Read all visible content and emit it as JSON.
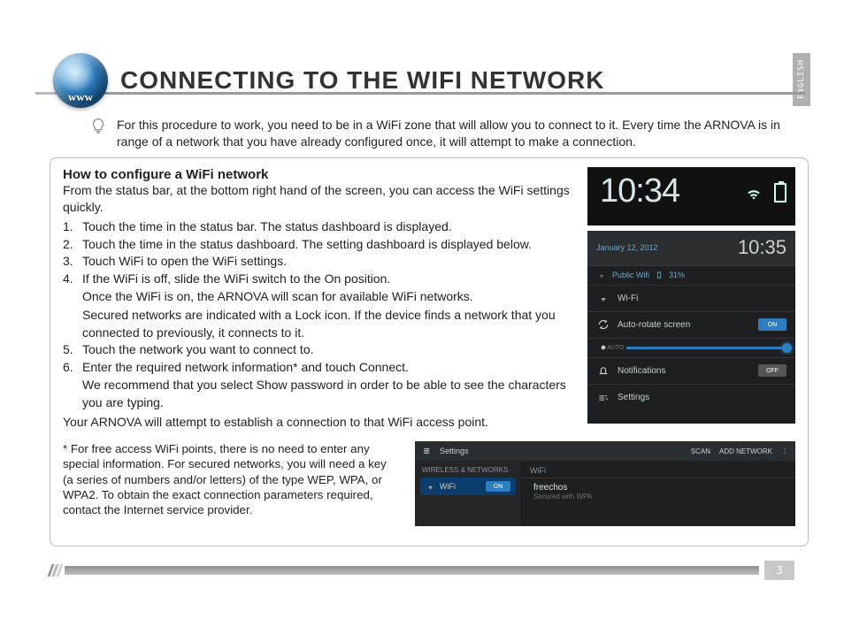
{
  "lang_tab": "ENGLISH",
  "globe_text": "www",
  "page_title": "CONNECTING TO THE WIFI NETWORK",
  "intro": "For this procedure to work, you need to be in a WiFi zone that will allow you to connect to it. Every time the ARNOVA is in range of a network that you have already configured once, it will attempt to make a connection.",
  "box": {
    "heading": "How to configure a WiFi network",
    "desc": "From the status bar, at the bottom right hand of the screen, you can access the WiFi settings quickly.",
    "steps": [
      {
        "n": "1.",
        "t": "Touch the time in the status bar. The status dashboard is displayed."
      },
      {
        "n": "2.",
        "t": "Touch the time in the status dashboard. The setting dashboard is displayed below."
      },
      {
        "n": "3.",
        "t": "Touch WiFi to open the WiFi settings."
      },
      {
        "n": "4.",
        "t": "If the WiFi is off, slide the WiFi switch to the On position.",
        "subs": [
          "Once the WiFi is on, the ARNOVA will scan for available WiFi networks.",
          "Secured networks are indicated with a Lock icon. If the device finds a network that you connected to previously, it connects to it."
        ]
      },
      {
        "n": "5.",
        "t": "Touch the network you want to connect to."
      },
      {
        "n": "6.",
        "t": "Enter the required network information* and touch Connect.",
        "subs": [
          "We recommend that you select Show password in order to be able to see the characters you are typing."
        ]
      }
    ],
    "foot": "Your ARNOVA will attempt to establish a connection to that WiFi access point.",
    "footnote": "* For free access WiFi points, there is no need to enter any special information. For secured networks, you will need a key (a series of numbers and/or letters) of the type WEP, WPA, or WPA2. To obtain the exact connection parameters required, contact the Internet service provider."
  },
  "shot1": {
    "time": "10:34"
  },
  "shot2": {
    "date": "January 12, 2012",
    "time": "10:35",
    "public_wifi": "Public Wifi",
    "signal": "31%",
    "rows": {
      "wifi": "Wi-Fi",
      "autorotate": "Auto-rotate screen",
      "on": "ON",
      "off": "OFF",
      "auto": "AUTO",
      "notifications": "Notifications",
      "settings": "Settings"
    }
  },
  "shot3": {
    "settings": "Settings",
    "scan": "SCAN",
    "add": "ADD NETWORK",
    "section": "WIRELESS & NETWORKS",
    "wifi": "WiFi",
    "on": "ON",
    "wifi_header": "WiFi",
    "net_name": "freechos",
    "net_sec": "Secured with WPA"
  },
  "page_number": "3"
}
